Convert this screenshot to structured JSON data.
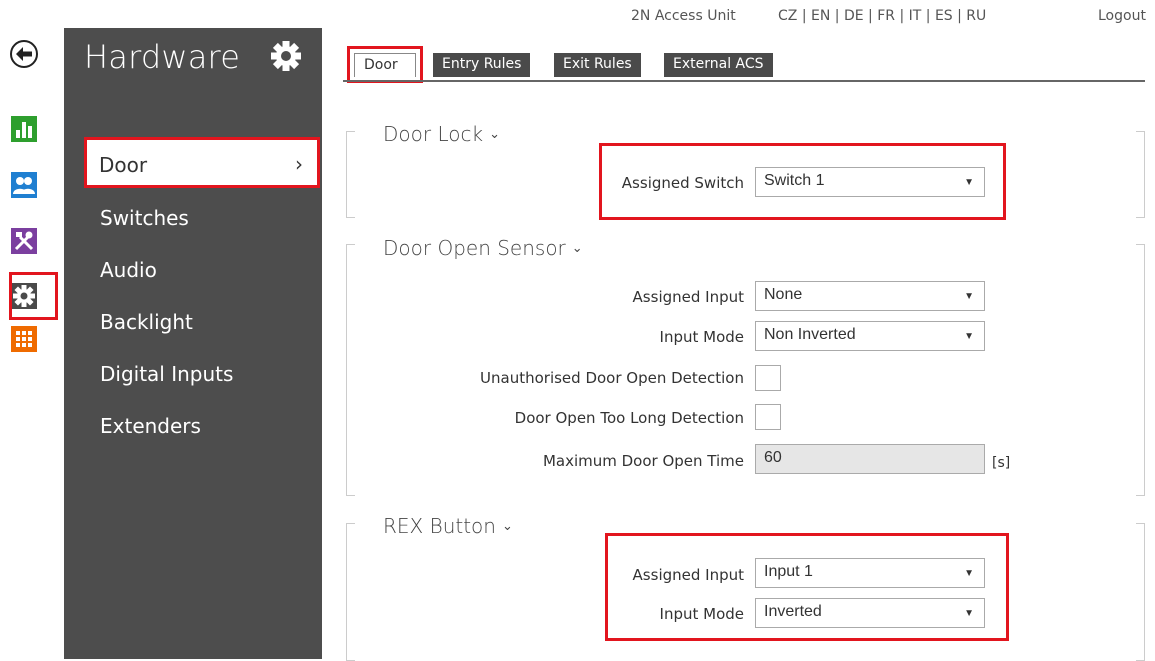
{
  "header": {
    "device_name": "2N Access Unit",
    "languages": [
      "CZ",
      "EN",
      "DE",
      "FR",
      "IT",
      "ES",
      "RU"
    ],
    "logout_label": "Logout"
  },
  "rail": {
    "icons": [
      "back-arrow-icon",
      "status-chart-icon",
      "users-icon",
      "services-tools-icon",
      "hardware-gear-icon",
      "system-grid-icon"
    ],
    "colors": {
      "status": "#2e9f2e",
      "users": "#1f7fd1",
      "services": "#7b3f9f",
      "hardware": "#4a4a4a",
      "system": "#ef6b00"
    },
    "selected": "hardware-gear-icon"
  },
  "sidebar": {
    "title": "Hardware",
    "items": [
      {
        "label": "Door",
        "selected": true,
        "chevron": "›"
      },
      {
        "label": "Switches"
      },
      {
        "label": "Audio"
      },
      {
        "label": "Backlight"
      },
      {
        "label": "Digital Inputs"
      },
      {
        "label": "Extenders"
      }
    ]
  },
  "tabs": [
    {
      "label": "Door",
      "active": true
    },
    {
      "label": "Entry Rules"
    },
    {
      "label": "Exit Rules"
    },
    {
      "label": "External ACS"
    }
  ],
  "sections": {
    "door_lock": {
      "title": "Door Lock",
      "assigned_switch_label": "Assigned Switch",
      "assigned_switch_value": "Switch 1"
    },
    "door_open_sensor": {
      "title": "Door Open Sensor",
      "assigned_input_label": "Assigned Input",
      "assigned_input_value": "None",
      "input_mode_label": "Input Mode",
      "input_mode_value": "Non Inverted",
      "unauth_label": "Unauthorised Door Open Detection",
      "unauth_checked": false,
      "too_long_label": "Door Open Too Long Detection",
      "too_long_checked": false,
      "max_time_label": "Maximum Door Open Time",
      "max_time_value": "60",
      "max_time_unit": "[s]"
    },
    "rex_button": {
      "title": "REX Button",
      "assigned_input_label": "Assigned Input",
      "assigned_input_value": "Input 1",
      "input_mode_label": "Input Mode",
      "input_mode_value": "Inverted"
    }
  },
  "glyphs": {
    "caret": "⌄",
    "select_arrow": "▼"
  },
  "highlight_color": "#e2151e"
}
